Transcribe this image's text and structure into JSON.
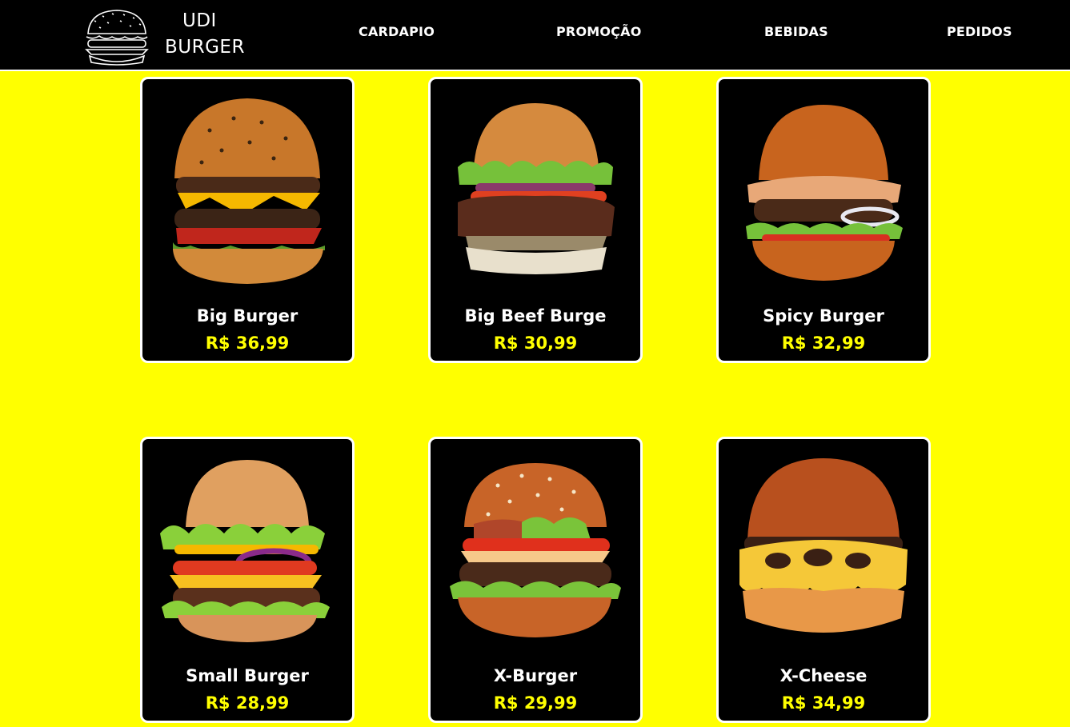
{
  "brand": {
    "line1": "UDI",
    "line2": "BURGER"
  },
  "nav": [
    {
      "label": "CARDAPIO"
    },
    {
      "label": "PROMOÇÃO"
    },
    {
      "label": "BEBIDAS"
    },
    {
      "label": "PEDIDOS"
    }
  ],
  "colors": {
    "background": "#ffff00",
    "card": "#000000",
    "price": "#ffff00",
    "text": "#ffffff"
  },
  "products": [
    {
      "name": "Big Burger",
      "price": "R$ 36,99",
      "icon": "burger-image"
    },
    {
      "name": "Big Beef Burge",
      "price": "R$ 30,99",
      "icon": "burger-image"
    },
    {
      "name": "Spicy Burger",
      "price": "R$ 32,99",
      "icon": "burger-image"
    },
    {
      "name": "Small Burger",
      "price": "R$ 28,99",
      "icon": "burger-image"
    },
    {
      "name": "X-Burger",
      "price": "R$ 29,99",
      "icon": "burger-image"
    },
    {
      "name": "X-Cheese",
      "price": "R$ 34,99",
      "icon": "burger-image"
    }
  ]
}
